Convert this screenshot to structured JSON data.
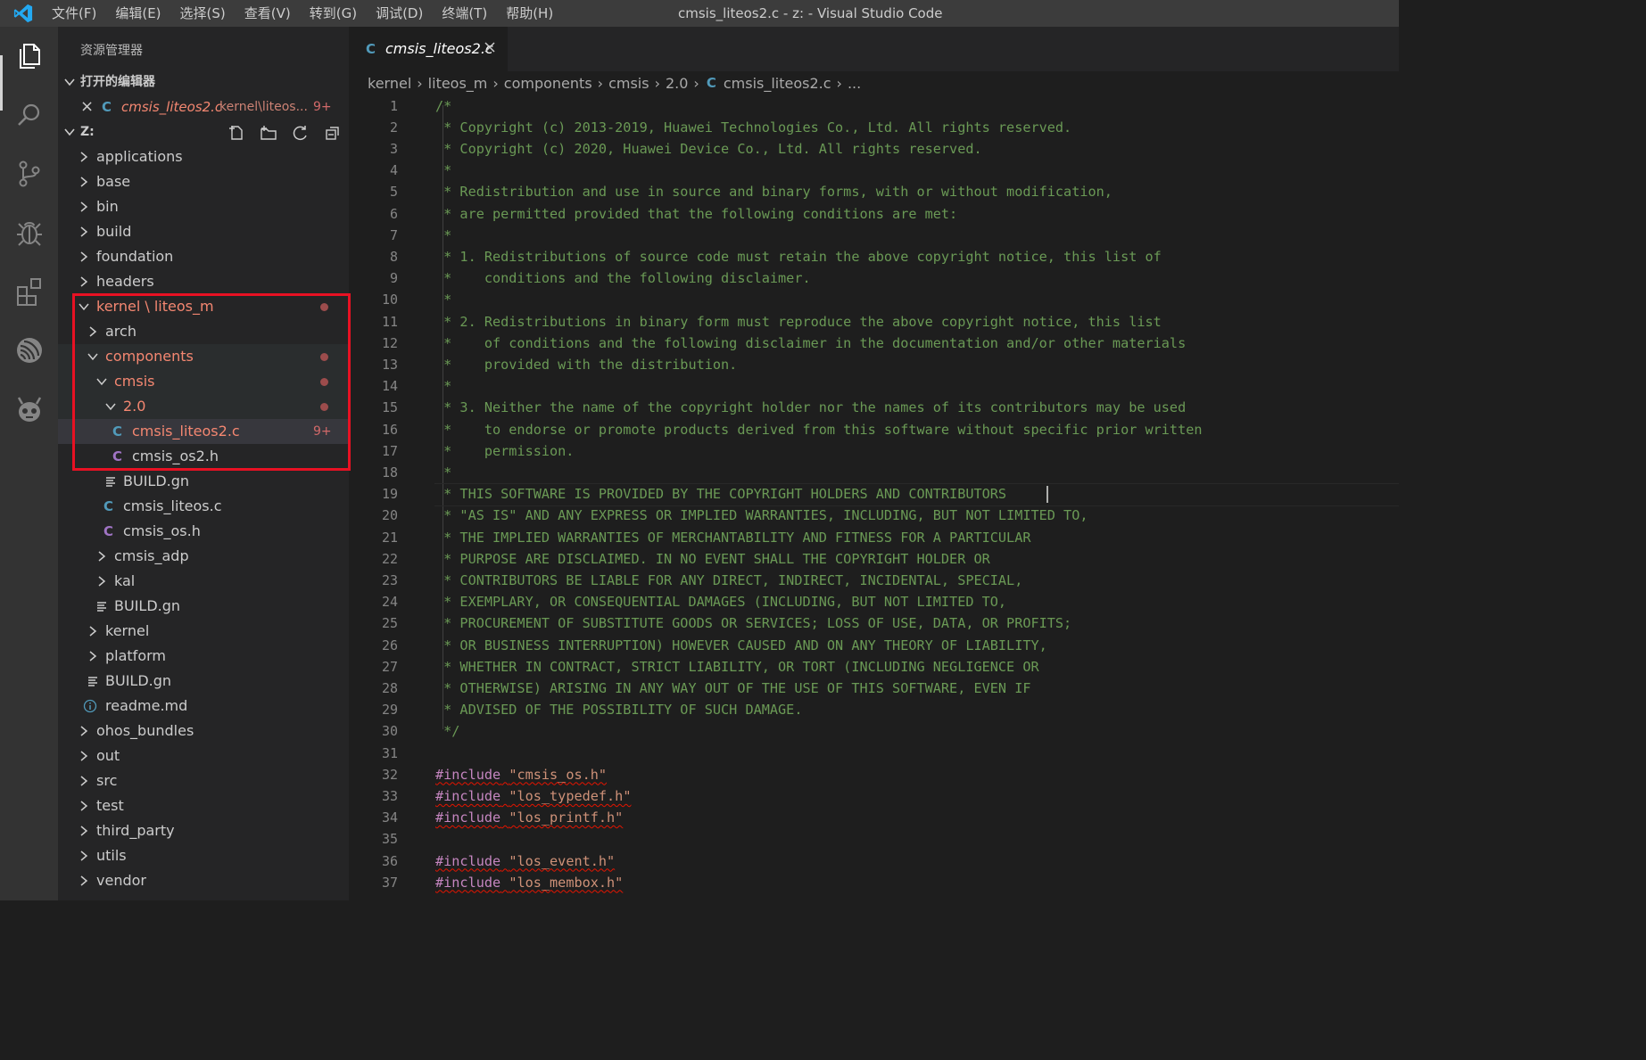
{
  "window": {
    "title": "cmsis_liteos2.c - z: - Visual Studio Code",
    "menu": [
      "文件(F)",
      "编辑(E)",
      "选择(S)",
      "查看(V)",
      "转到(G)",
      "调试(D)",
      "终端(T)",
      "帮助(H)"
    ]
  },
  "activity_bar": [
    "explorer-icon",
    "search-icon",
    "source-control-icon",
    "debug-icon",
    "extensions-icon",
    "remote-icon",
    "robot-icon"
  ],
  "sidebar": {
    "title": "资源管理器",
    "open_editors_header": "打开的编辑器",
    "open_editor": {
      "close": "×",
      "type": "C",
      "name": "cmsis_liteos2.c",
      "path": "kernel\\liteos...",
      "badge": "9+"
    },
    "workspace_header": "Z:",
    "tree": [
      "applications",
      "base",
      "bin",
      "build",
      "foundation",
      "headers",
      "kernel \\ liteos_m",
      "arch",
      "components",
      "cmsis",
      "2.0",
      "cmsis_liteos2.c",
      "cmsis_os2.h",
      "BUILD.gn",
      "cmsis_liteos.c",
      "cmsis_os.h",
      "cmsis_adp",
      "kal",
      "BUILD.gn",
      "kernel",
      "platform",
      "BUILD.gn",
      "readme.md",
      "ohos_bundles",
      "out",
      "src",
      "test",
      "third_party",
      "utils",
      "vendor"
    ],
    "badge_9": "9+",
    "c_letter": "C"
  },
  "tab": {
    "name": "cmsis_liteos2.c",
    "type": "C"
  },
  "breadcrumb": [
    "kernel",
    "liteos_m",
    "components",
    "cmsis",
    "2.0",
    "C",
    "cmsis_liteos2.c",
    "..."
  ],
  "editor": {
    "lines": [
      "/*",
      " * Copyright (c) 2013-2019, Huawei Technologies Co., Ltd. All rights reserved.",
      " * Copyright (c) 2020, Huawei Device Co., Ltd. All rights reserved.",
      " *",
      " * Redistribution and use in source and binary forms, with or without modification,",
      " * are permitted provided that the following conditions are met:",
      " *",
      " * 1. Redistributions of source code must retain the above copyright notice, this list of",
      " *    conditions and the following disclaimer.",
      " *",
      " * 2. Redistributions in binary form must reproduce the above copyright notice, this list",
      " *    of conditions and the following disclaimer in the documentation and/or other materials",
      " *    provided with the distribution.",
      " *",
      " * 3. Neither the name of the copyright holder nor the names of its contributors may be used",
      " *    to endorse or promote products derived from this software without specific prior written",
      " *    permission.",
      " *",
      " * THIS SOFTWARE IS PROVIDED BY THE COPYRIGHT HOLDERS AND CONTRIBUTORS",
      " * \"AS IS\" AND ANY EXPRESS OR IMPLIED WARRANTIES, INCLUDING, BUT NOT LIMITED TO,",
      " * THE IMPLIED WARRANTIES OF MERCHANTABILITY AND FITNESS FOR A PARTICULAR",
      " * PURPOSE ARE DISCLAIMED. IN NO EVENT SHALL THE COPYRIGHT HOLDER OR",
      " * CONTRIBUTORS BE LIABLE FOR ANY DIRECT, INDIRECT, INCIDENTAL, SPECIAL,",
      " * EXEMPLARY, OR CONSEQUENTIAL DAMAGES (INCLUDING, BUT NOT LIMITED TO,",
      " * PROCUREMENT OF SUBSTITUTE GOODS OR SERVICES; LOSS OF USE, DATA, OR PROFITS;",
      " * OR BUSINESS INTERRUPTION) HOWEVER CAUSED AND ON ANY THEORY OF LIABILITY,",
      " * WHETHER IN CONTRACT, STRICT LIABILITY, OR TORT (INCLUDING NEGLIGENCE OR",
      " * OTHERWISE) ARISING IN ANY WAY OUT OF THE USE OF THIS SOFTWARE, EVEN IF",
      " * ADVISED OF THE POSSIBILITY OF SUCH DAMAGE.",
      " */",
      "",
      "#include \"cmsis_os.h\"",
      "#include \"los_typedef.h\"",
      "#include \"los_printf.h\"",
      "",
      "#include \"los_event.h\"",
      "#include \"los_membox.h\""
    ]
  },
  "colors": {
    "comment": "#6a9955",
    "include": "#c586c0",
    "string": "#ce9178",
    "modified": "#f48771",
    "highlight_box": "#e81123"
  }
}
